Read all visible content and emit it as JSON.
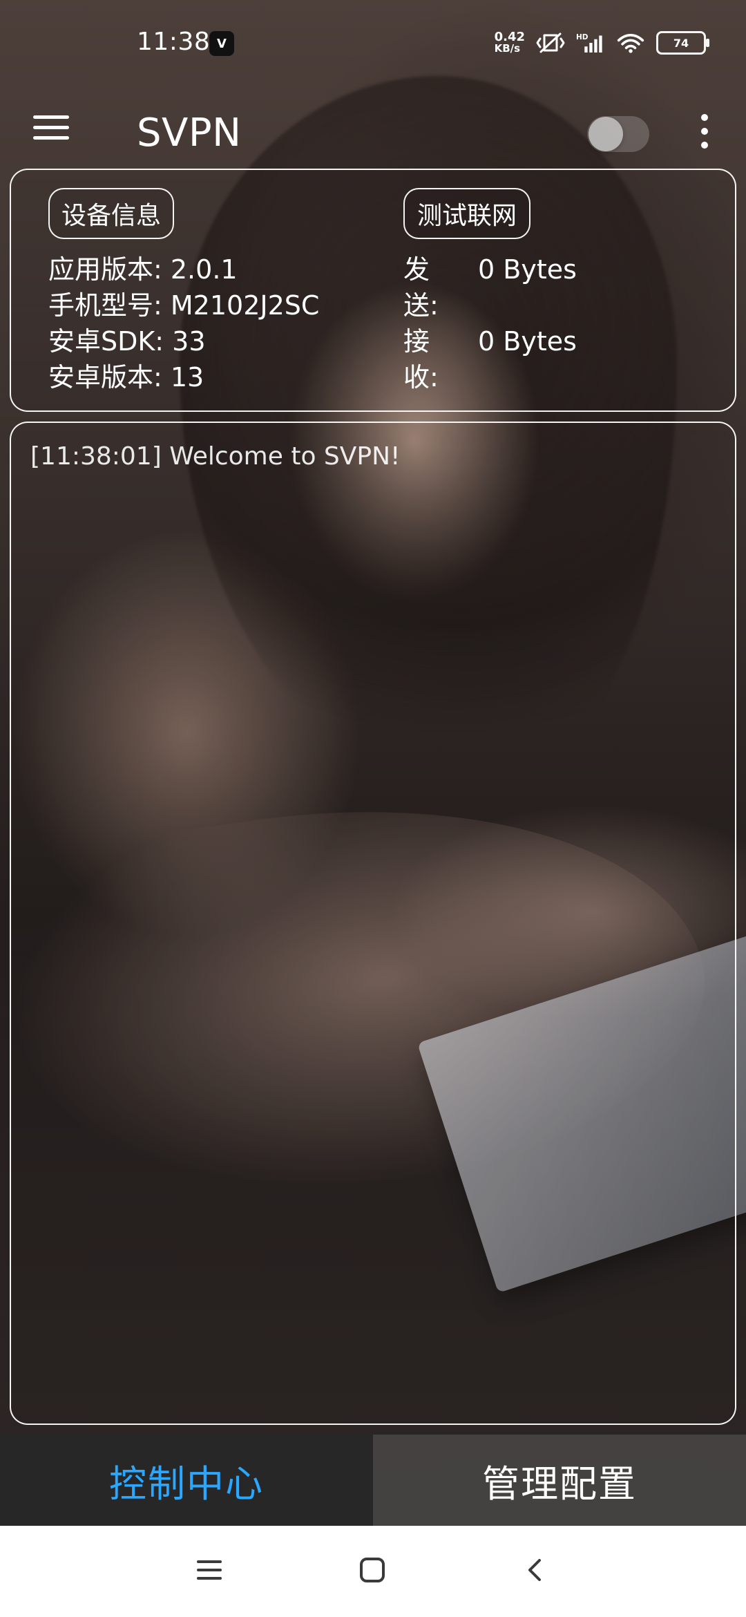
{
  "status_bar": {
    "time": "11:38",
    "app_icon_label": "V",
    "network_speed_value": "0.42",
    "network_speed_unit": "KB/s",
    "hd_label": "HD",
    "battery_level": "74",
    "icons": [
      "vibration-off-icon",
      "signal-icon",
      "wifi-icon",
      "battery-icon"
    ]
  },
  "toolbar": {
    "title": "SVPN",
    "toggle_state": "off",
    "icons": [
      "menu-icon",
      "overflow-menu-icon"
    ]
  },
  "device_panel": {
    "device_info_button": "设备信息",
    "test_connection_button": "测试联网",
    "info_lines": [
      "应用版本: 2.0.1",
      "手机型号: M2102J2SC",
      "安卓SDK: 33",
      "安卓版本: 13"
    ],
    "stats": {
      "send_label": "发送:",
      "send_value": "0 Bytes",
      "receive_label": "接收:",
      "receive_value": "0 Bytes"
    }
  },
  "log": {
    "entries": [
      "[11:38:01] Welcome to SVPN!"
    ]
  },
  "bottom_tabs": {
    "tabs": [
      {
        "label": "控制中心",
        "active": true
      },
      {
        "label": "管理配置",
        "active": false
      }
    ],
    "active_color": "#2aa7ff"
  },
  "nav_bar": {
    "icons": [
      "recent-apps-icon",
      "home-icon",
      "back-icon"
    ]
  }
}
